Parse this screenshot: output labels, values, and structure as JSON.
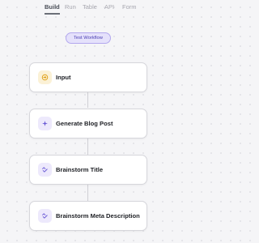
{
  "tabs": [
    {
      "label": "Build",
      "active": true
    },
    {
      "label": "Run",
      "active": false
    },
    {
      "label": "Table",
      "active": false
    },
    {
      "label": "API",
      "active": false
    },
    {
      "label": "Form",
      "active": false
    }
  ],
  "workflow": {
    "name": "Test Workflow"
  },
  "nodes": [
    {
      "label": "Input",
      "icon": "input-icon",
      "icon_bg": "#fbf1d6",
      "icon_color": "#e0a21c"
    },
    {
      "label": "Generate Blog Post",
      "icon": "sparkle-icon",
      "icon_bg": "#ede9fc",
      "icon_color": "#6b5bd6"
    },
    {
      "label": "Brainstorm Title",
      "icon": "link-icon",
      "icon_bg": "#ede9fc",
      "icon_color": "#6b5bd6"
    },
    {
      "label": "Brainstorm Meta Description",
      "icon": "link-icon",
      "icon_bg": "#ede9fc",
      "icon_color": "#6b5bd6"
    }
  ],
  "colors": {
    "accent": "#6b5bd6",
    "pill_bg": "#e5e1fb",
    "pill_text": "#4b3fb3",
    "canvas_bg": "#f5f5f7"
  }
}
